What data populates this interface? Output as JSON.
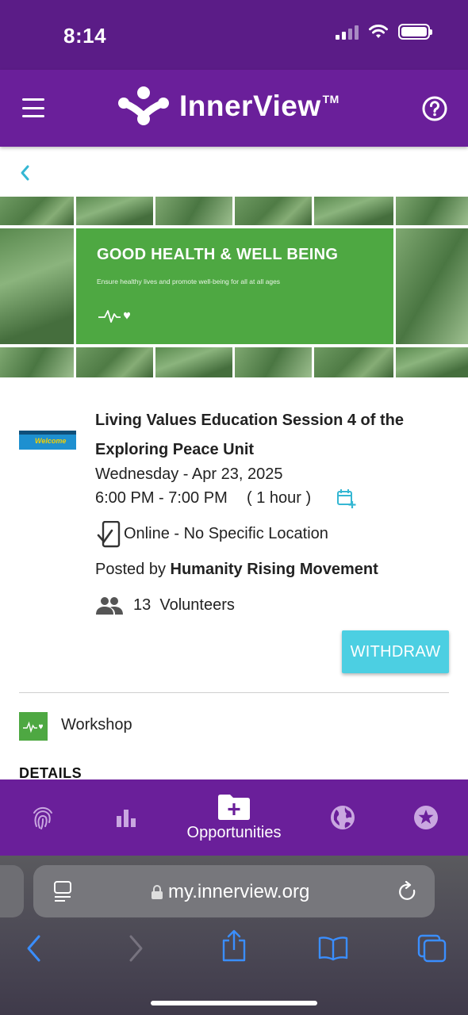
{
  "status_bar": {
    "time": "8:14"
  },
  "header": {
    "brand": "InnerView",
    "trademark": "TM"
  },
  "banner": {
    "title": "GOOD HEALTH & WELL BEING",
    "subtitle": "Ensure healthy lives and promote well-being for all at all ages"
  },
  "event": {
    "thumb_text": "Welcome",
    "title": "Living Values Education Session 4 of the Exploring Peace Unit",
    "date": "Wednesday - Apr 23, 2025",
    "time": "6:00 PM - 7:00 PM",
    "duration": "( 1 hour )",
    "location": "Online - No Specific Location",
    "posted_by_prefix": "Posted by",
    "organizer": "Humanity Rising Movement",
    "volunteer_count": "13",
    "volunteer_label": "Volunteers",
    "withdraw_label": "WITHDRAW",
    "category": "Workshop",
    "details_heading": "DETAILS"
  },
  "bottom_nav": {
    "items": [
      {
        "icon": "fingerprint-icon",
        "label": ""
      },
      {
        "icon": "bar-chart-icon",
        "label": ""
      },
      {
        "icon": "folder-add-icon",
        "label": "Opportunities"
      },
      {
        "icon": "globe-icon",
        "label": ""
      },
      {
        "icon": "star-icon",
        "label": ""
      }
    ]
  },
  "browser": {
    "url": "my.innerview.org"
  },
  "colors": {
    "brand_purple": "#6a1f9a",
    "accent_cyan": "#4ccfe2",
    "banner_green": "#4ea842"
  }
}
